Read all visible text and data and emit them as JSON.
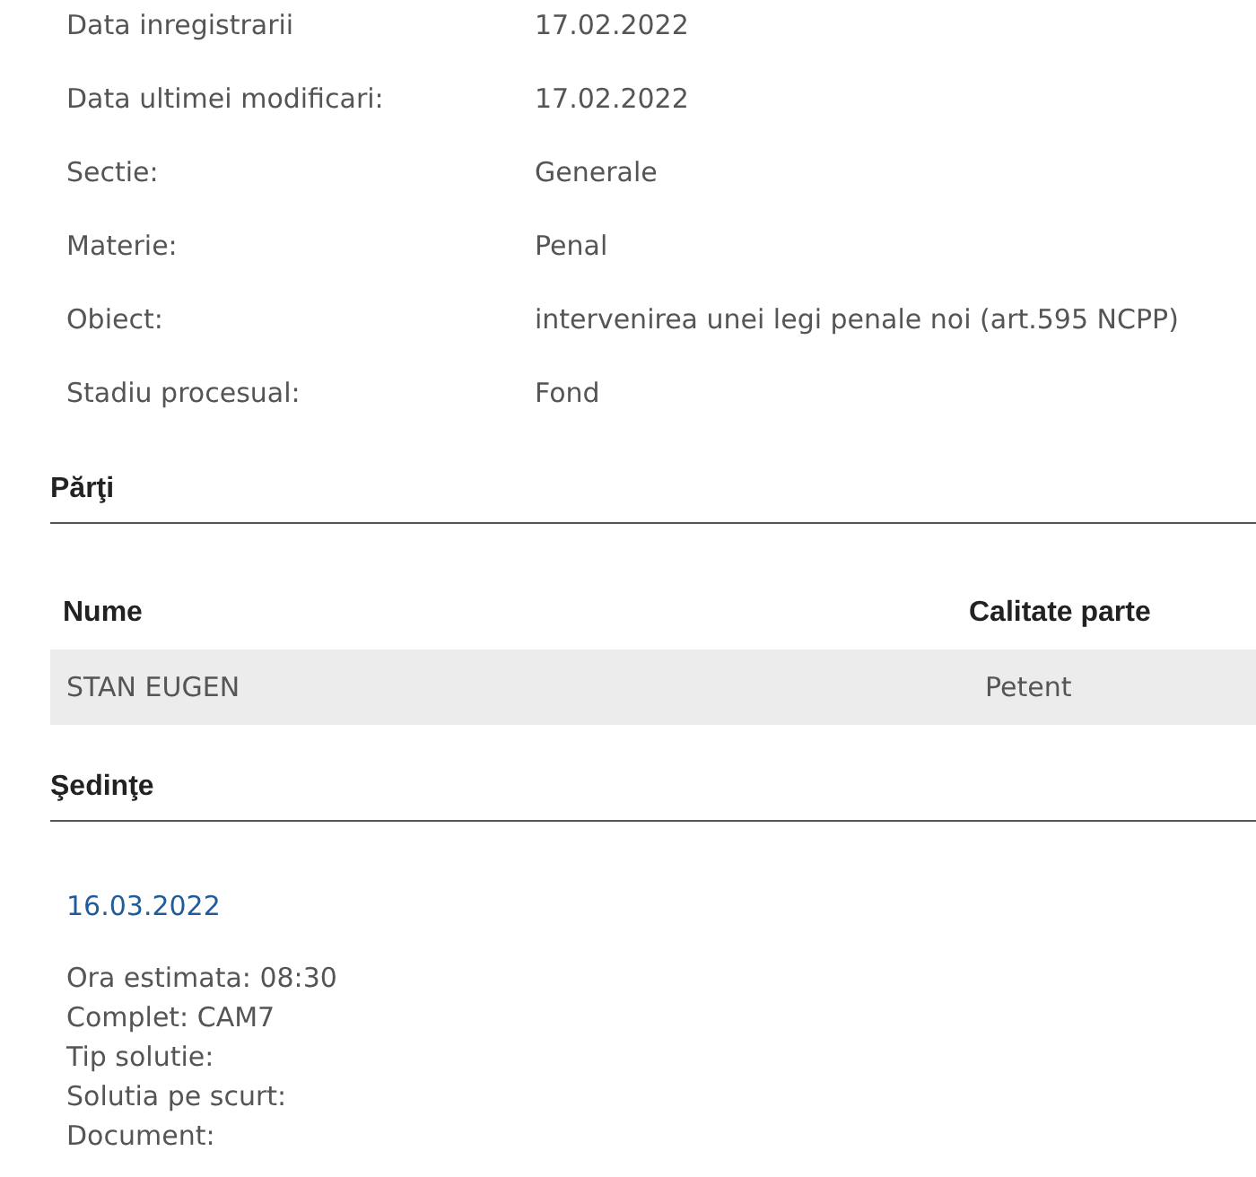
{
  "details": [
    {
      "label": "Data inregistrarii",
      "value": "17.02.2022"
    },
    {
      "label": "Data ultimei modificari:",
      "value": "17.02.2022"
    },
    {
      "label": "Sectie:",
      "value": "Generale"
    },
    {
      "label": "Materie:",
      "value": "Penal"
    },
    {
      "label": "Obiect:",
      "value": "intervenirea unei legi penale noi (art.595 NCPP)"
    },
    {
      "label": "Stadiu procesual:",
      "value": "Fond"
    }
  ],
  "parties": {
    "title": "Părţi",
    "columns": [
      "Nume",
      "Calitate parte"
    ],
    "rows": [
      [
        "STAN EUGEN",
        "Petent"
      ]
    ]
  },
  "hearings": {
    "title": "Şedinţe",
    "items": [
      {
        "date": "16.03.2022",
        "lines": [
          "Ora estimata: 08:30",
          "Complet: CAM7",
          "Tip solutie:",
          "Solutia pe scurt:",
          "Document:"
        ]
      }
    ]
  }
}
